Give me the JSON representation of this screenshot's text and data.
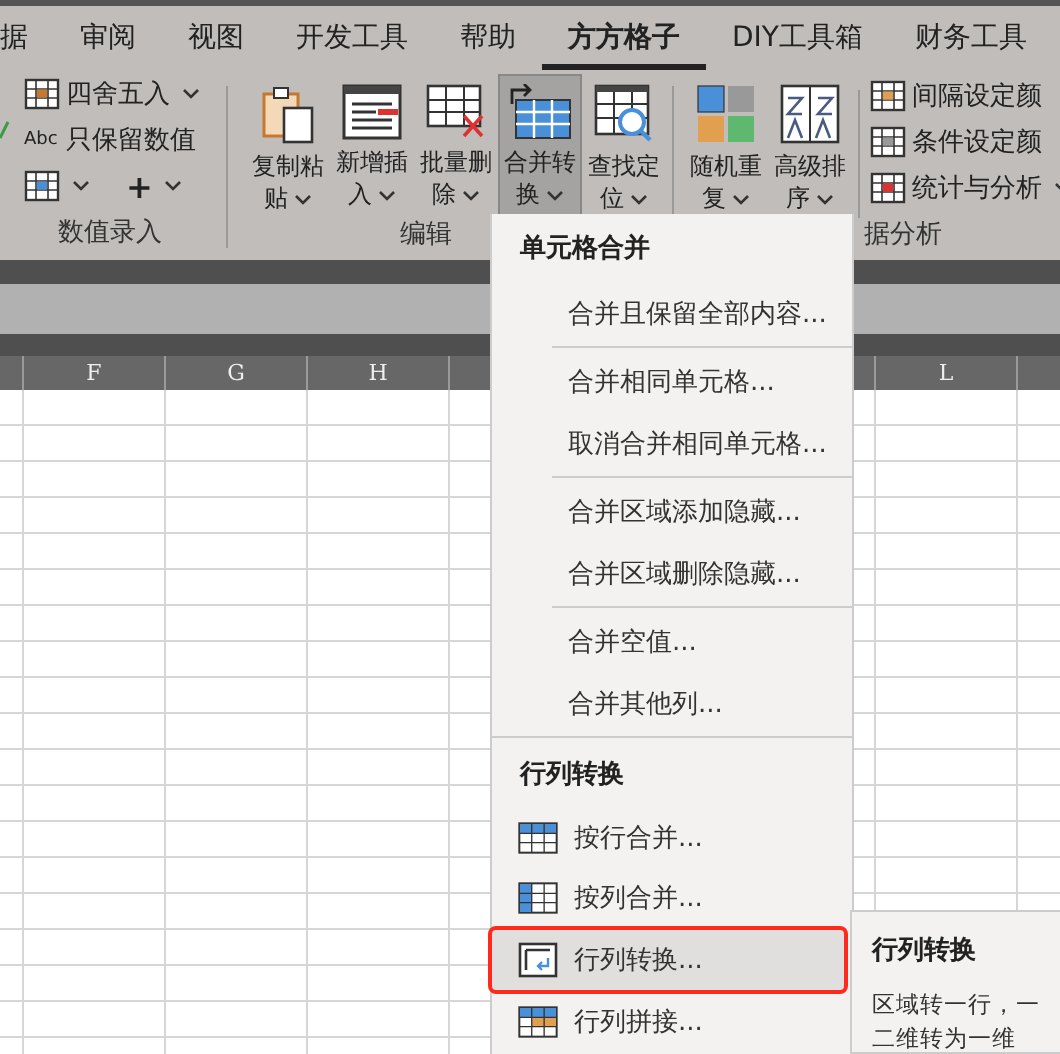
{
  "tabs": [
    {
      "label": "据",
      "selected": false
    },
    {
      "label": "审阅",
      "selected": false
    },
    {
      "label": "视图",
      "selected": false
    },
    {
      "label": "开发工具",
      "selected": false
    },
    {
      "label": "帮助",
      "selected": false
    },
    {
      "label": "方方格子",
      "selected": true
    },
    {
      "label": "DIY工具箱",
      "selected": false
    },
    {
      "label": "财务工具",
      "selected": false
    }
  ],
  "ribbon": {
    "number_entry": {
      "label": "数值录入",
      "rows": [
        {
          "label": "四舍五入",
          "dropdown": true
        },
        {
          "badge": "Abc",
          "label": "只保留数值",
          "dropdown": false
        }
      ],
      "tools": [
        {
          "dropdown": true
        },
        {
          "label": "+",
          "dropdown": true
        }
      ]
    },
    "edit": {
      "label": "编辑",
      "buttons": [
        {
          "label": "复制粘贴",
          "pressed": false
        },
        {
          "label": "新增插入",
          "pressed": false
        },
        {
          "label": "批量删除",
          "pressed": false
        },
        {
          "label": "合并转换",
          "pressed": true
        },
        {
          "label": "查找定位",
          "pressed": false
        }
      ]
    },
    "analysis": {
      "label": "据分析",
      "buttons": [
        {
          "label": "随机重复"
        },
        {
          "label": "高级排序"
        }
      ],
      "rows": [
        {
          "label": "间隔设定颜"
        },
        {
          "label": "条件设定颜"
        },
        {
          "label": "统计与分析",
          "dropdown": true
        }
      ]
    }
  },
  "column_headers": [
    "F",
    "G",
    "H",
    "L"
  ],
  "menu": {
    "sections": [
      {
        "title": "单元格合并",
        "groups": [
          [
            {
              "label": "合并且保留全部内容...",
              "selected": false
            }
          ],
          [
            {
              "label": "合并相同单元格...",
              "selected": false
            },
            {
              "label": "取消合并相同单元格...",
              "selected": false
            }
          ],
          [
            {
              "label": "合并区域添加隐藏...",
              "selected": false
            },
            {
              "label": "合并区域删除隐藏...",
              "selected": false
            }
          ],
          [
            {
              "label": "合并空值...",
              "selected": false
            },
            {
              "label": "合并其他列...",
              "selected": false
            }
          ]
        ]
      },
      {
        "title": "行列转换",
        "items": [
          {
            "label": "按行合并...",
            "selected": false
          },
          {
            "label": "按列合并...",
            "selected": false
          },
          {
            "label": "行列转换...",
            "selected": true
          },
          {
            "label": "行列拼接...",
            "selected": false
          }
        ]
      }
    ]
  },
  "tooltip": {
    "title": "行列转换",
    "lines": [
      "区域转一行，一",
      "二维转为一维"
    ]
  }
}
